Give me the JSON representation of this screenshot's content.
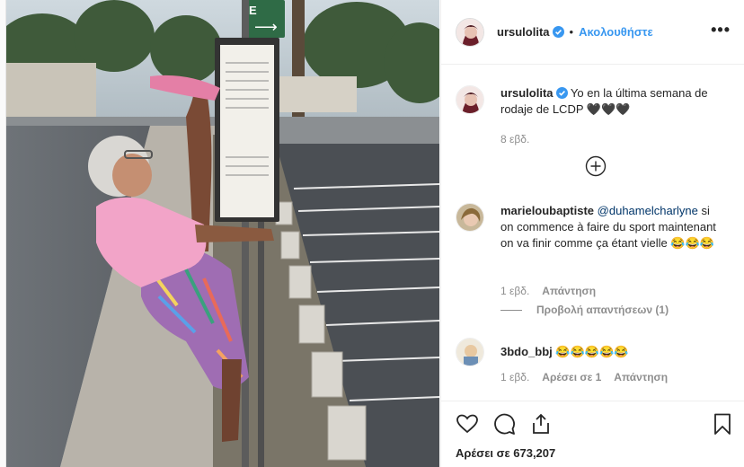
{
  "post": {
    "author": "ursulolita",
    "follow_label": "Ακολουθήστε",
    "separator": "•",
    "more_label": "•••"
  },
  "caption": {
    "username": "ursulolita",
    "text": "Yo en la última semana de rodaje de LCDP 🖤🖤🖤",
    "time": "8 εβδ."
  },
  "comments": [
    {
      "username": "marieloubaptiste",
      "mention": "@duhamelcharlyne",
      "text": "si on commence à faire du sport maintenant on va finir comme ça étant vielle 😂😂😂",
      "time": "1 εβδ.",
      "reply_label": "Απάντηση",
      "view_replies": "Προβολή απαντήσεων (1)"
    },
    {
      "username": "3bdo_bbj",
      "text": "😂😂😂😂😂",
      "time": "1 εβδ.",
      "likes_label": "Αρέσει σε 1",
      "reply_label": "Απάντηση"
    }
  ],
  "likes_text": "Αρέσει σε 673,207",
  "colors": {
    "accent": "#3897f0",
    "muted": "#8e8e8e",
    "border": "#efefef",
    "mention": "#003569"
  },
  "icons": [
    "verified-badge-icon",
    "more-options-icon",
    "add-comment-icon",
    "heart-icon",
    "comment-icon",
    "share-icon",
    "bookmark-icon"
  ],
  "photo": {
    "sign_text_1": "E",
    "sign_text_2": "⟶"
  }
}
